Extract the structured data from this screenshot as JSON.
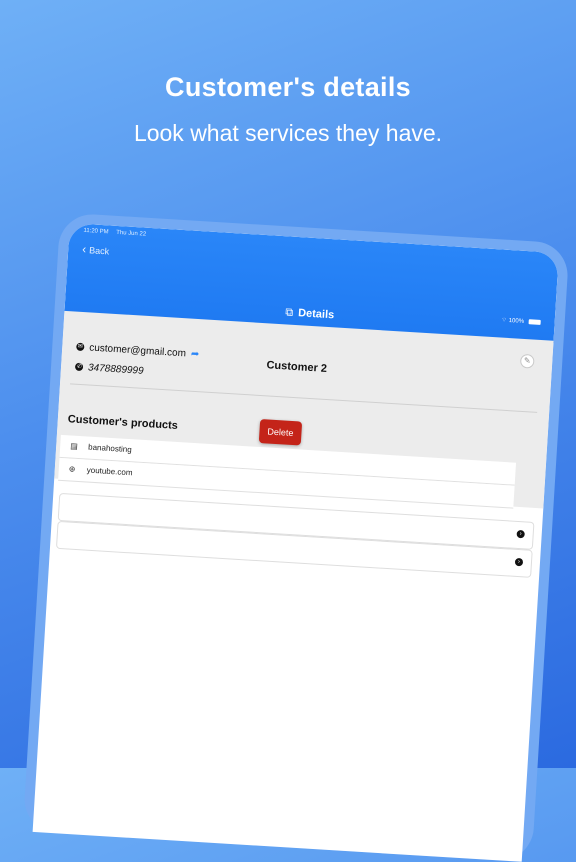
{
  "hero": {
    "title": "Customer's details",
    "subtitle": "Look what services they have."
  },
  "status_bar": {
    "time": "11:20 PM",
    "date": "Thu Jun 22",
    "battery": "100%"
  },
  "nav": {
    "back_label": "Back",
    "title": "Details",
    "title_icon": "scan-icon"
  },
  "customer": {
    "email": "customer@gmail.com",
    "phone": "3478889999",
    "name": "Customer 2"
  },
  "actions": {
    "delete_label": "Delete"
  },
  "products": {
    "heading": "Customer's products",
    "items": [
      {
        "label": "banahosting",
        "icon": "server-icon"
      },
      {
        "label": "youtube.com",
        "icon": "globe-icon"
      }
    ]
  },
  "colors": {
    "accent": "#2a86f8",
    "delete": "#c42419",
    "background_top": "#6fb0f6",
    "background_bottom": "#2b6ae0"
  }
}
